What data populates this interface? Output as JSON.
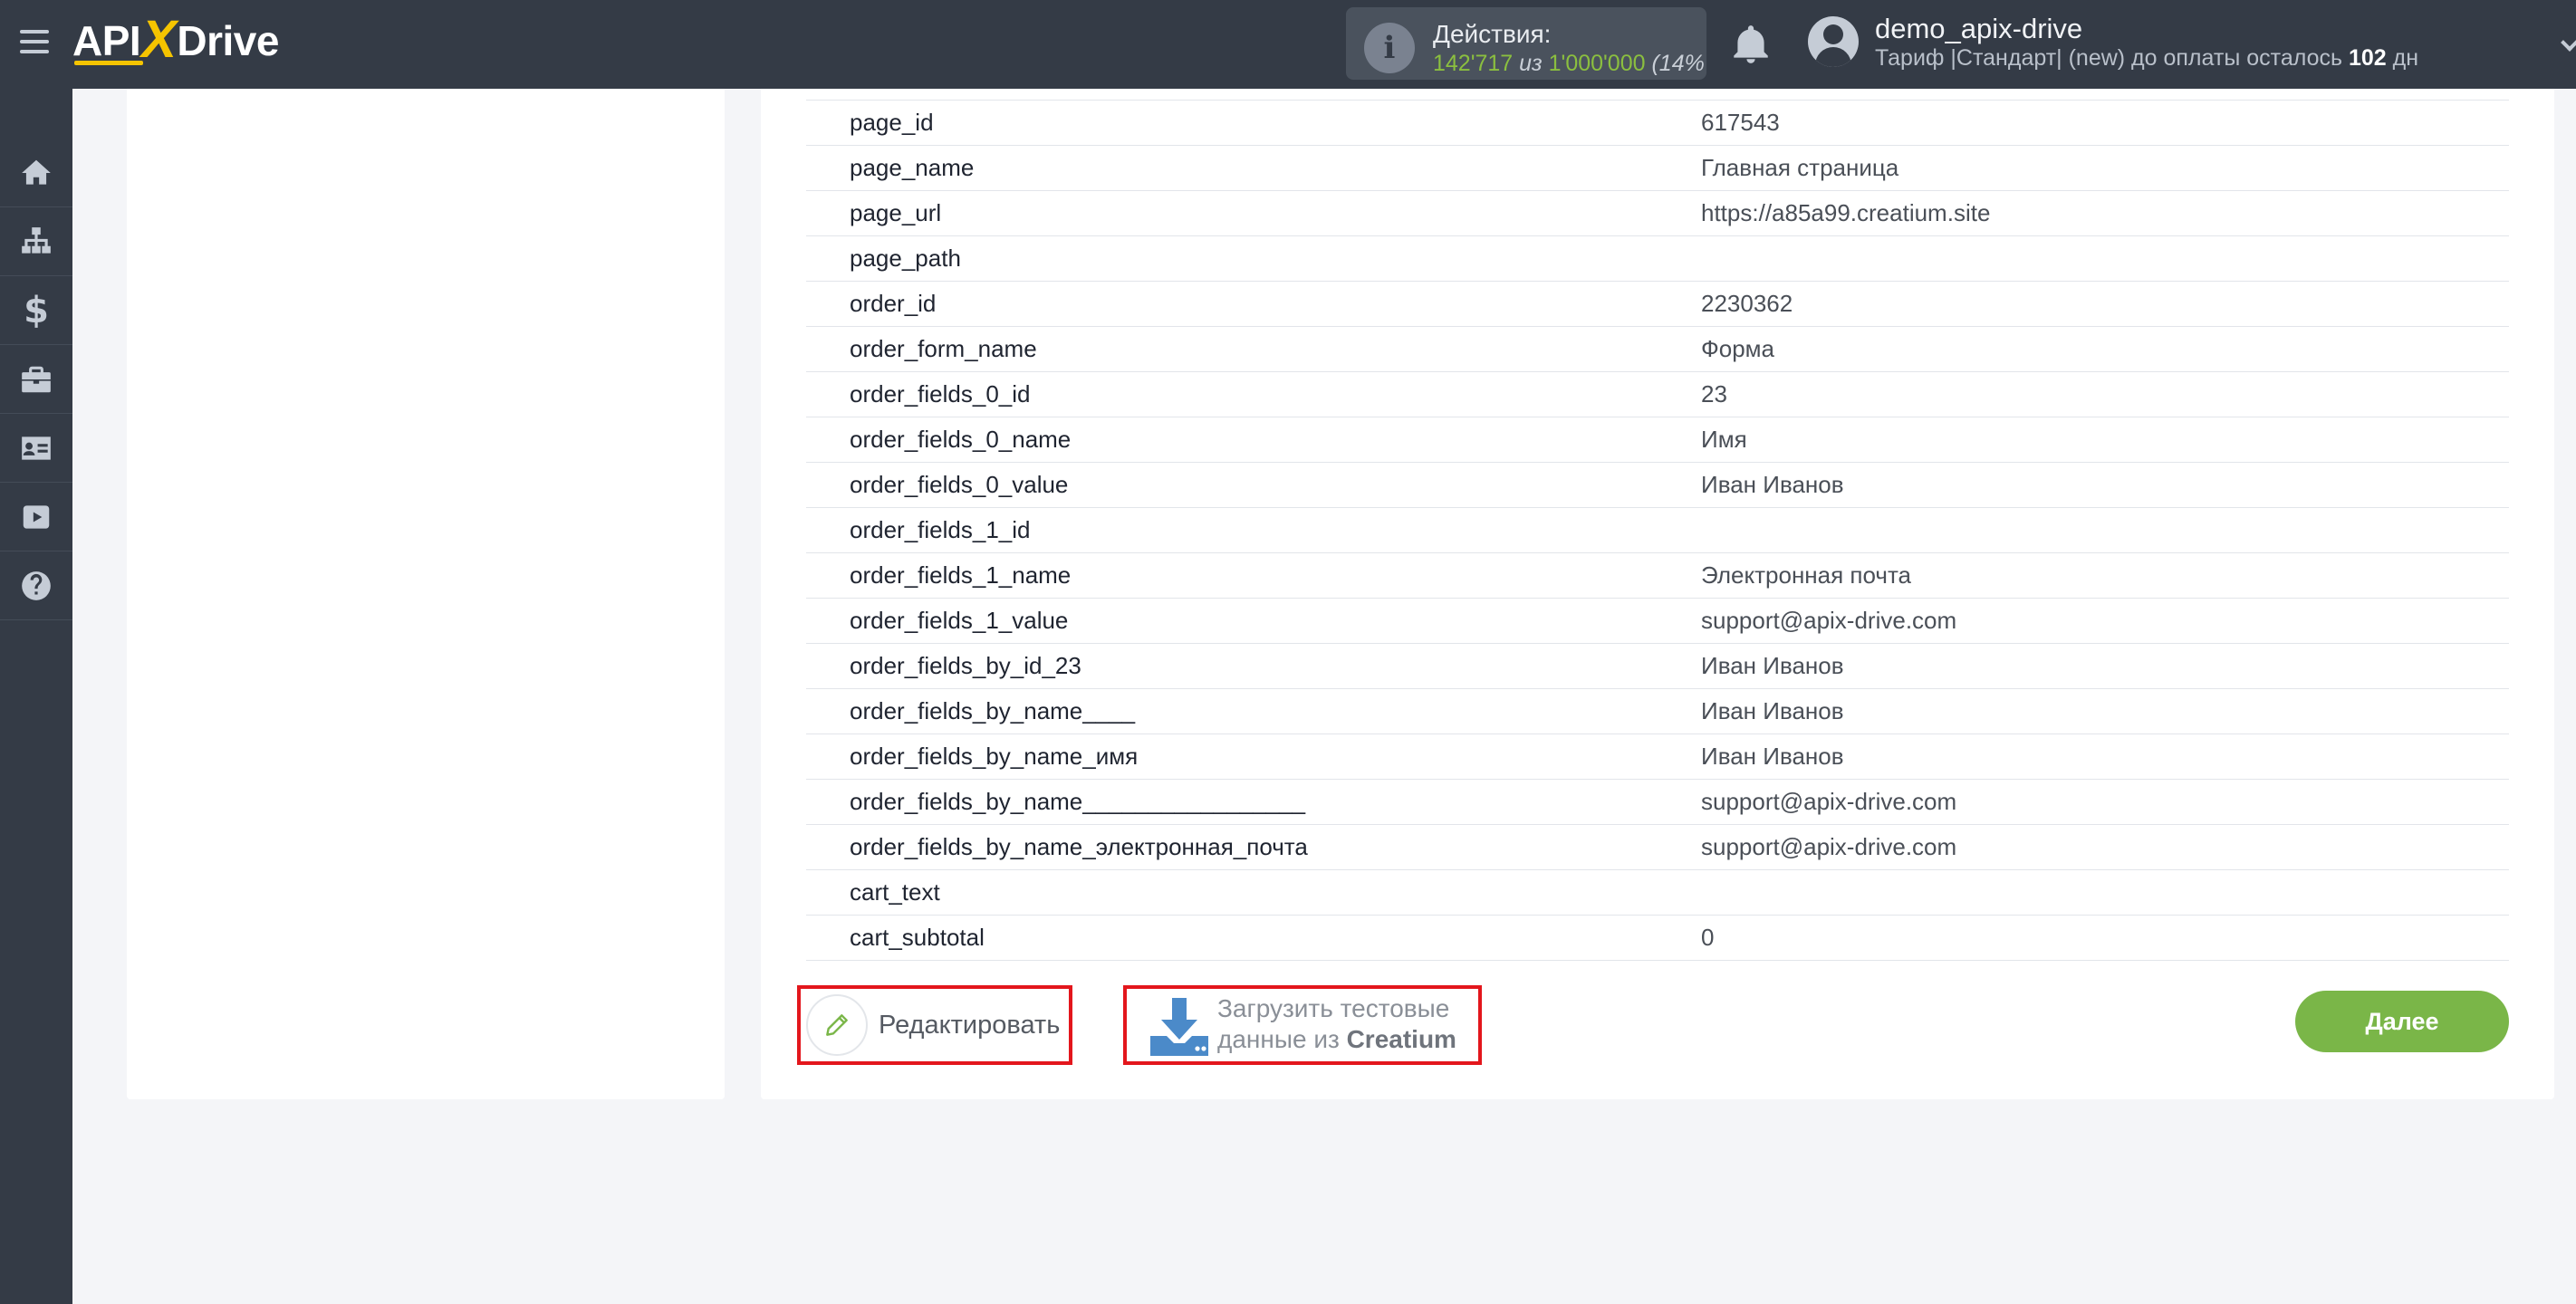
{
  "header": {
    "logo_api": "API",
    "logo_x": "X",
    "logo_drive": "Drive",
    "actions_label": "Действия:",
    "actions_used": "142'717",
    "actions_of": "из",
    "actions_total": "1'000'000",
    "actions_percent": "(14%",
    "username": "demo_apix-drive",
    "tariff_prefix": "Тариф |Стандарт| (new) до оплаты осталось",
    "tariff_days": "102",
    "tariff_suffix": "дн"
  },
  "sidebar": {
    "items": [
      {
        "icon": "home-icon"
      },
      {
        "icon": "sitemap-icon"
      },
      {
        "icon": "dollar-icon",
        "glyph": "$"
      },
      {
        "icon": "briefcase-icon"
      },
      {
        "icon": "contact-card-icon"
      },
      {
        "icon": "youtube-icon"
      },
      {
        "icon": "help-icon"
      }
    ]
  },
  "fields": [
    {
      "key": "page_id",
      "value": "617543"
    },
    {
      "key": "page_name",
      "value": "Главная страница"
    },
    {
      "key": "page_url",
      "value": "https://a85a99.creatium.site"
    },
    {
      "key": "page_path",
      "value": ""
    },
    {
      "key": "order_id",
      "value": "2230362"
    },
    {
      "key": "order_form_name",
      "value": "Форма"
    },
    {
      "key": "order_fields_0_id",
      "value": "23"
    },
    {
      "key": "order_fields_0_name",
      "value": "Имя"
    },
    {
      "key": "order_fields_0_value",
      "value": "Иван Иванов"
    },
    {
      "key": "order_fields_1_id",
      "value": ""
    },
    {
      "key": "order_fields_1_name",
      "value": "Электронная почта"
    },
    {
      "key": "order_fields_1_value",
      "value": "support@apix-drive.com"
    },
    {
      "key": "order_fields_by_id_23",
      "value": "Иван Иванов"
    },
    {
      "key": "order_fields_by_name____",
      "value": "Иван Иванов"
    },
    {
      "key": "order_fields_by_name_имя",
      "value": "Иван Иванов"
    },
    {
      "key": "order_fields_by_name_________________",
      "value": "support@apix-drive.com"
    },
    {
      "key": "order_fields_by_name_электронная_почта",
      "value": "support@apix-drive.com"
    },
    {
      "key": "cart_text",
      "value": ""
    },
    {
      "key": "cart_subtotal",
      "value": "0"
    }
  ],
  "buttons": {
    "edit": "Редактировать",
    "load_line1": "Загрузить тестовые",
    "load_line2_prefix": "данные из",
    "load_line2_brand": "Creatium",
    "next": "Далее"
  },
  "colors": {
    "topbar": "#343b46",
    "accent_green": "#7ab648",
    "highlight_red": "#e3161c",
    "logo_yellow": "#f5c400"
  }
}
